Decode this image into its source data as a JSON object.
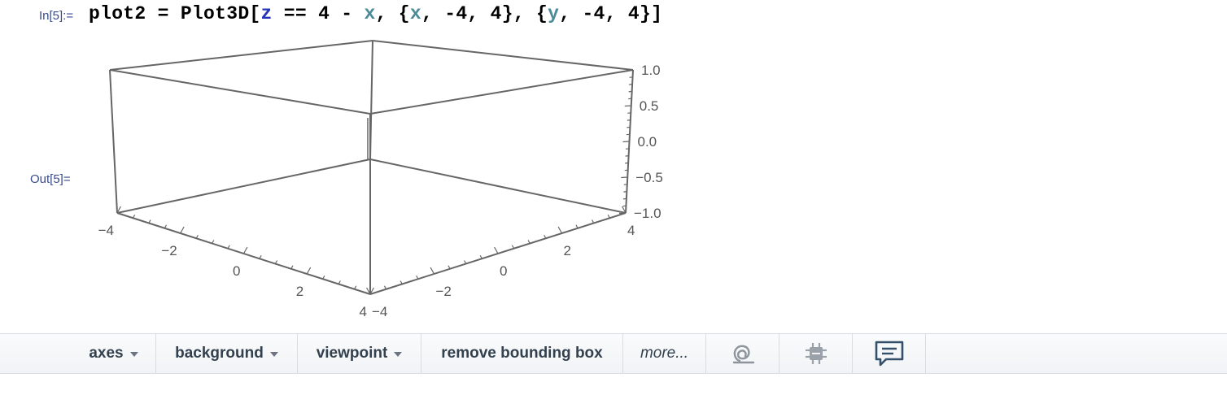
{
  "cell": {
    "in_label": "In[5]:=",
    "out_label": "Out[5]=",
    "input": {
      "part1": "plot2 = Plot3D[",
      "var_z": "z",
      "part2": " == 4 - ",
      "var_x1": "x",
      "part3": ", {",
      "var_x2": "x",
      "part4": ", -4, 4}, {",
      "var_y": "y",
      "part5": ", -4, 4}]"
    }
  },
  "plot": {
    "z_ticks": [
      "1.0",
      "0.5",
      "0.0",
      "−0.5",
      "−1.0"
    ],
    "x_ticks": [
      "−4",
      "−2",
      "0",
      "2",
      "4"
    ],
    "y_ticks": [
      "−4",
      "−2",
      "0",
      "2",
      "4"
    ],
    "line_color": "#666666"
  },
  "toolbar": {
    "axes_label": "axes",
    "background_label": "background",
    "viewpoint_label": "viewpoint",
    "remove_bbox_label": "remove bounding box",
    "more_label": "more...",
    "icons": [
      "spiral-icon",
      "chip-settings-icon",
      "comment-icon"
    ]
  }
}
